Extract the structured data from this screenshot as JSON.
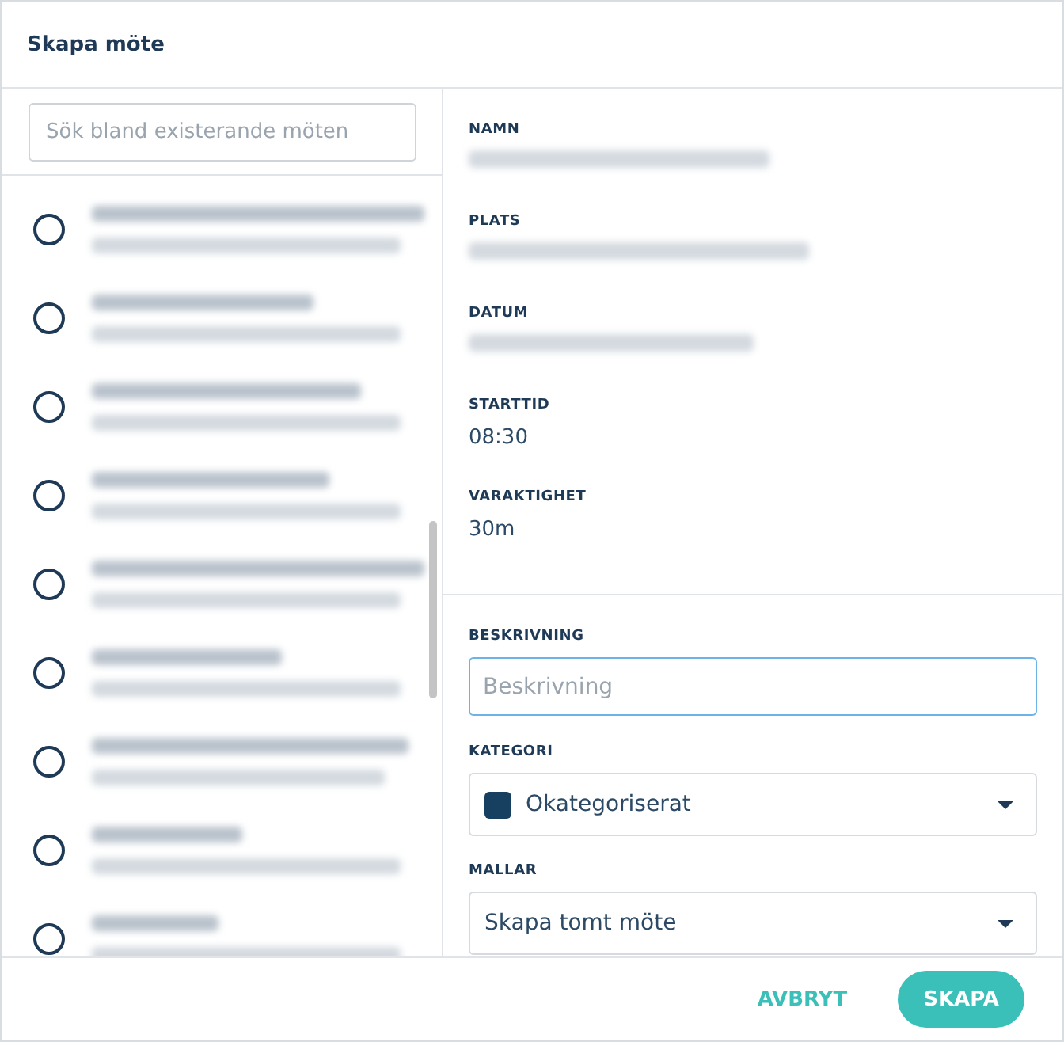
{
  "window": {
    "title": "Skapa möte"
  },
  "search": {
    "placeholder": "Sök bland existerande möten"
  },
  "meetings": [
    {
      "selected": false
    },
    {
      "selected": false
    },
    {
      "selected": false
    },
    {
      "selected": false
    },
    {
      "selected": false
    },
    {
      "selected": false
    },
    {
      "selected": false
    },
    {
      "selected": false
    },
    {
      "selected": false
    }
  ],
  "details": [
    {
      "label": "NAMN",
      "kind": "redacted"
    },
    {
      "label": "PLATS",
      "kind": "redacted"
    },
    {
      "label": "DATUM",
      "kind": "redacted"
    },
    {
      "label": "STARTTID",
      "kind": "text",
      "value": "08:30"
    },
    {
      "label": "VARAKTIGHET",
      "kind": "text",
      "value": "30m"
    }
  ],
  "description": {
    "label": "BESKRIVNING",
    "placeholder": "Beskrivning"
  },
  "category": {
    "label": "KATEGORI",
    "value": "Okategoriserat",
    "color": "#173f5f"
  },
  "template": {
    "label": "MALLAR",
    "value": "Skapa tomt möte"
  },
  "buttons": [
    {
      "label": "AVBRYT",
      "kind": "text"
    },
    {
      "label": "SKAPA",
      "kind": "primary"
    }
  ]
}
